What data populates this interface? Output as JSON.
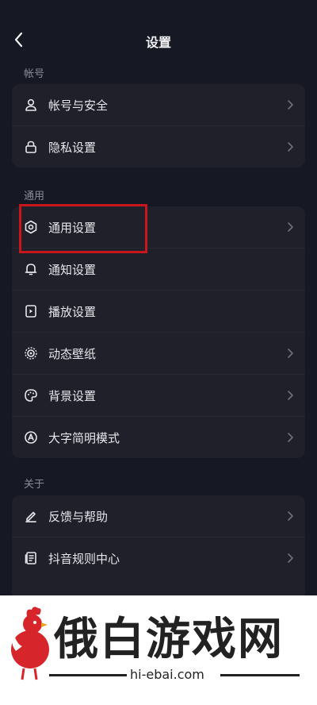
{
  "header": {
    "title": "设置"
  },
  "sections": [
    {
      "title": "帐号",
      "items": [
        {
          "label": "帐号与安全",
          "icon": "user-icon"
        },
        {
          "label": "隐私设置",
          "icon": "lock-icon"
        }
      ]
    },
    {
      "title": "通用",
      "items": [
        {
          "label": "通用设置",
          "icon": "gear-icon"
        },
        {
          "label": "通知设置",
          "icon": "bell-icon"
        },
        {
          "label": "播放设置",
          "icon": "play-settings-icon"
        },
        {
          "label": "动态壁纸",
          "icon": "wallpaper-icon"
        },
        {
          "label": "背景设置",
          "icon": "palette-icon"
        },
        {
          "label": "大字简明模式",
          "icon": "large-font-icon"
        }
      ]
    },
    {
      "title": "关于",
      "items": [
        {
          "label": "反馈与帮助",
          "icon": "pencil-icon"
        },
        {
          "label": "抖音规则中心",
          "icon": "document-icon"
        }
      ]
    }
  ],
  "watermark": {
    "text": "俄白游戏网",
    "domain": "hi-ebai.com"
  },
  "colors": {
    "background": "#161823",
    "card": "#1f2029",
    "highlight": "#c8161d"
  }
}
